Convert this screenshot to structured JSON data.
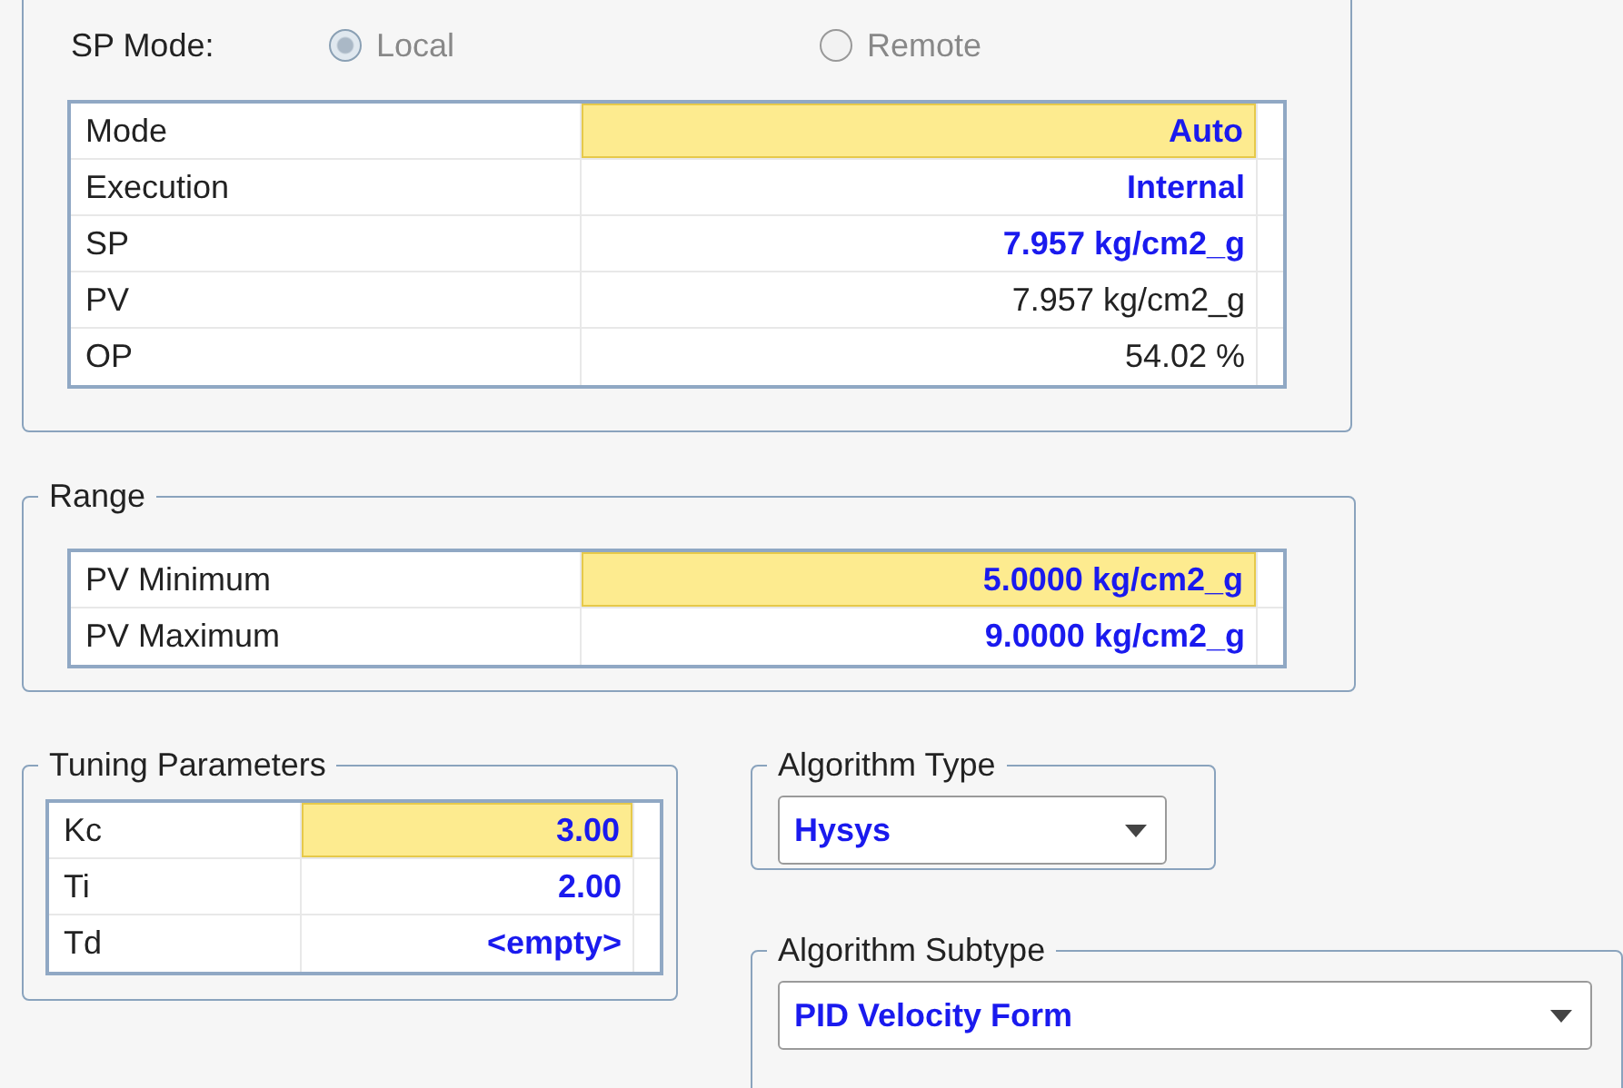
{
  "sp_mode": {
    "label": "SP Mode:",
    "disabled": true,
    "options": [
      {
        "label": "Local",
        "selected": true
      },
      {
        "label": "Remote",
        "selected": false
      }
    ]
  },
  "status_table": {
    "rows": [
      {
        "label": "Mode",
        "value": "Auto",
        "editable": true,
        "selected": true
      },
      {
        "label": "Execution",
        "value": "Internal",
        "editable": true,
        "selected": false
      },
      {
        "label": "SP",
        "value": "7.957 kg/cm2_g",
        "editable": true,
        "selected": false
      },
      {
        "label": "PV",
        "value": "7.957 kg/cm2_g",
        "editable": false,
        "selected": false
      },
      {
        "label": "OP",
        "value": "54.02 %",
        "editable": false,
        "selected": false
      }
    ]
  },
  "range": {
    "title": "Range",
    "rows": [
      {
        "label": "PV Minimum",
        "value": "5.0000 kg/cm2_g",
        "editable": true,
        "selected": true
      },
      {
        "label": "PV Maximum",
        "value": "9.0000 kg/cm2_g",
        "editable": true,
        "selected": false
      }
    ]
  },
  "tuning": {
    "title": "Tuning Parameters",
    "rows": [
      {
        "label": "Kc",
        "value": "3.00",
        "editable": true,
        "selected": true
      },
      {
        "label": "Ti",
        "value": "2.00",
        "editable": true,
        "selected": false
      },
      {
        "label": "Td",
        "value": "<empty>",
        "editable": true,
        "selected": false
      }
    ]
  },
  "algorithm_type": {
    "title": "Algorithm Type",
    "value": "Hysys"
  },
  "algorithm_subtype": {
    "title": "Algorithm Subtype",
    "value": "PID Velocity Form"
  }
}
